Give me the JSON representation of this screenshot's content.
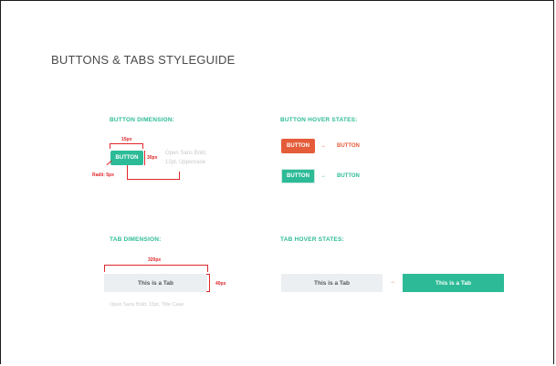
{
  "page": {
    "title": "BUTTONS & TABS STYLEGUIDE"
  },
  "button_dimension": {
    "heading": "BUTTON DIMENSION:",
    "button_label": "BUTTON",
    "width_label": "15px",
    "height_label": "30px",
    "radius_label": "Radii: 5px",
    "note_line1": "Open Sans Bold,",
    "note_line2": "12pt, Uppercase"
  },
  "button_hover": {
    "heading": "BUTTON HOVER STATES:",
    "rows": [
      {
        "button_label": "BUTTON",
        "arrow": "→",
        "result_label": "BUTTON",
        "color": "#e55c3a"
      },
      {
        "button_label": "BUTTON",
        "arrow": "→",
        "result_label": "BUTTON",
        "color": "#2dbb97"
      }
    ]
  },
  "tab_dimension": {
    "heading": "TAB DIMENSION:",
    "width_label": "320px",
    "height_label": "40px",
    "tab_label": "This is a Tab",
    "note": "Open Sans Bold, 15pt, Title Case"
  },
  "tab_hover": {
    "heading": "TAB HOVER STATES:",
    "default_tab_label": "This is a Tab",
    "arrow": "→",
    "hover_tab_label": "This is a Tab"
  },
  "colors": {
    "teal": "#2dbb97",
    "orange": "#e55c3a",
    "red_dimension": "#e0262b",
    "tab_grey": "#eceff1"
  }
}
